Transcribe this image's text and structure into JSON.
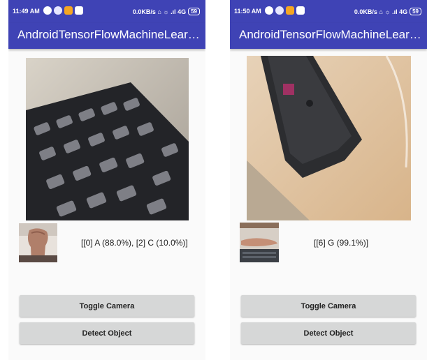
{
  "screens": [
    {
      "status_time": "11:49 AM",
      "status_right": "0.0KB/s ⌂ ☼ .ıl 4G",
      "battery": "59",
      "app_title": "AndroidTensorFlowMachineLearni…",
      "result": "[[0] A (88.0%), [2] C (10.0%)]",
      "toggle_label": "Toggle Camera",
      "detect_label": "Detect Object"
    },
    {
      "status_time": "11:50 AM",
      "status_right": "0.0KB/s ⌂ ☼ .ıl 4G",
      "battery": "59",
      "app_title": "AndroidTensorFlowMachineLearni…",
      "result": "[[6] G (99.1%)]",
      "toggle_label": "Toggle Camera",
      "detect_label": "Detect Object"
    }
  ],
  "colors": {
    "app_bar": "#3f43b5",
    "button": "#d6d7d7",
    "background": "#fafafa"
  }
}
